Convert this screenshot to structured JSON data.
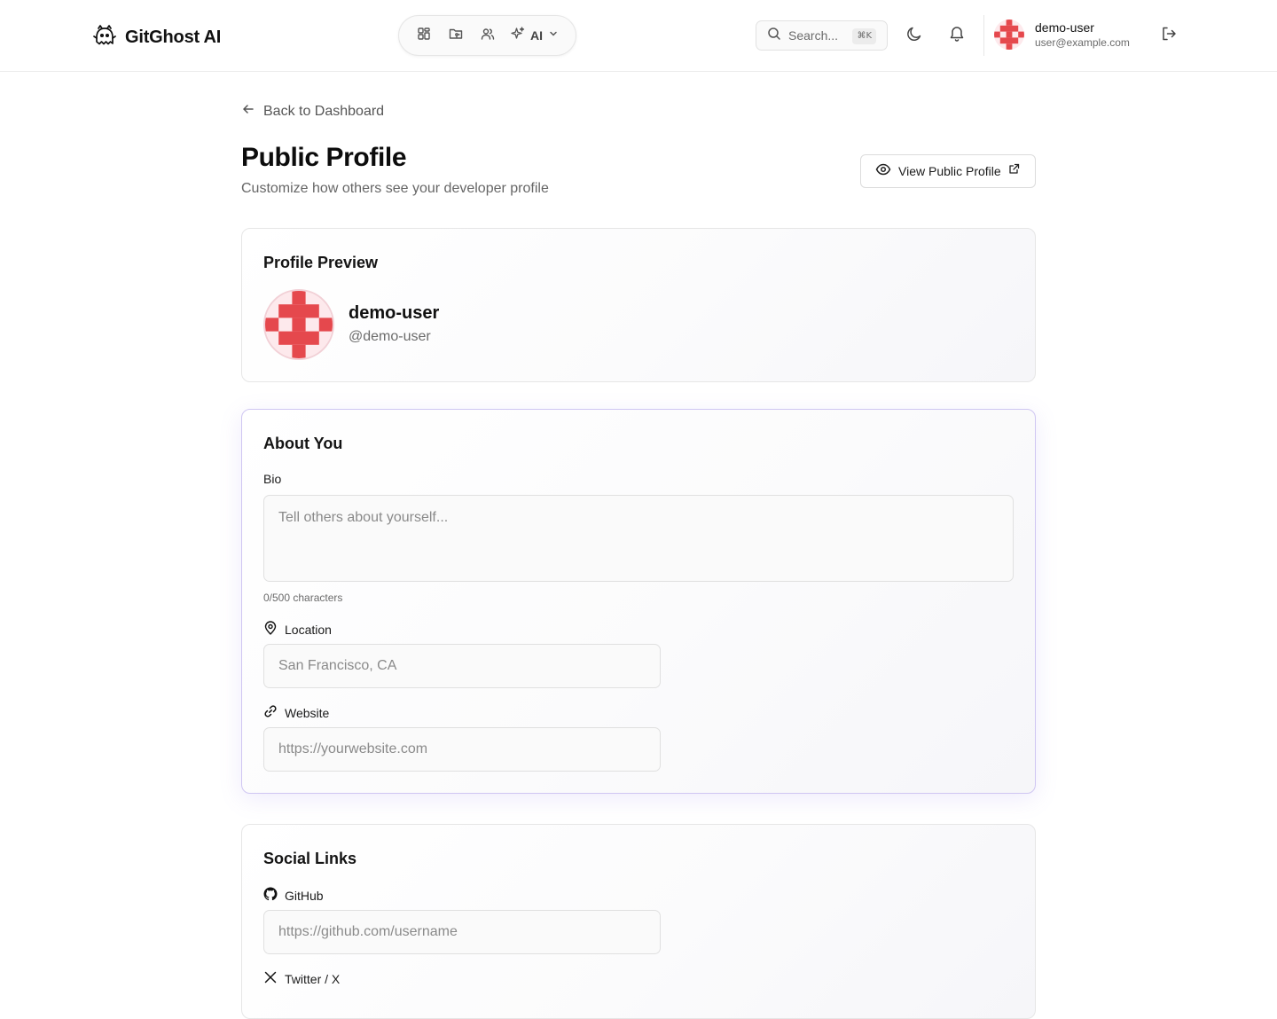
{
  "app": {
    "name": "GitGhost AI"
  },
  "nav": {
    "ai_label": "AI"
  },
  "search": {
    "placeholder": "Search...",
    "shortcut": "⌘K"
  },
  "user": {
    "name": "demo-user",
    "email": "user@example.com"
  },
  "page": {
    "back_label": "Back to Dashboard",
    "title": "Public Profile",
    "subtitle": "Customize how others see your developer profile",
    "view_button": "View Public Profile"
  },
  "preview": {
    "title": "Profile Preview",
    "name": "demo-user",
    "handle": "@demo-user"
  },
  "about": {
    "title": "About You",
    "bio_label": "Bio",
    "bio_placeholder": "Tell others about yourself...",
    "bio_value": "",
    "bio_counter": "0/500 characters",
    "location_label": "Location",
    "location_placeholder": "San Francisco, CA",
    "location_value": "",
    "website_label": "Website",
    "website_placeholder": "https://yourwebsite.com",
    "website_value": ""
  },
  "social": {
    "title": "Social Links",
    "github_label": "GitHub",
    "github_placeholder": "https://github.com/username",
    "github_value": "",
    "twitter_label": "Twitter / X"
  },
  "colors": {
    "avatar_red": "#e5484d",
    "avatar_light": "#fde9ec",
    "accent_border": "#cfc6f2"
  }
}
